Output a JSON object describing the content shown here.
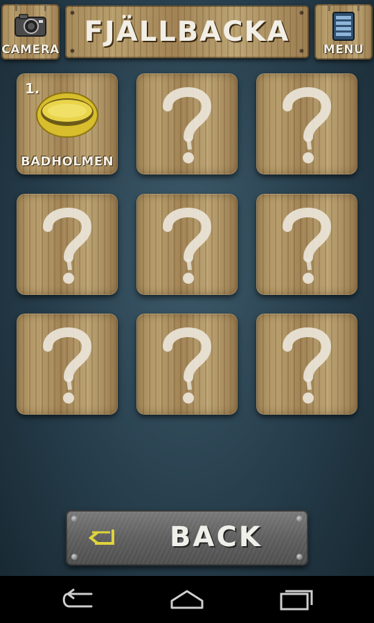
{
  "header": {
    "title": "FJÄLLBACKA",
    "camera_label": "CAMERA",
    "menu_label": "MENU"
  },
  "tiles": [
    {
      "number": "1.",
      "name": "BADHOLMEN",
      "state": "unlocked",
      "icon": "ring-icon"
    },
    {
      "state": "locked",
      "icon": "question-mark-icon"
    },
    {
      "state": "locked",
      "icon": "question-mark-icon"
    },
    {
      "state": "locked",
      "icon": "question-mark-icon"
    },
    {
      "state": "locked",
      "icon": "question-mark-icon"
    },
    {
      "state": "locked",
      "icon": "question-mark-icon"
    },
    {
      "state": "locked",
      "icon": "question-mark-icon"
    },
    {
      "state": "locked",
      "icon": "question-mark-icon"
    },
    {
      "state": "locked",
      "icon": "question-mark-icon"
    }
  ],
  "back_button": {
    "label": "BACK",
    "icon": "back-arrow-icon"
  },
  "colors": {
    "ring_gold": "#e3c93a",
    "arrow_yellow": "#e0d43a"
  },
  "system_nav": [
    "back-icon",
    "home-icon",
    "recent-apps-icon"
  ]
}
